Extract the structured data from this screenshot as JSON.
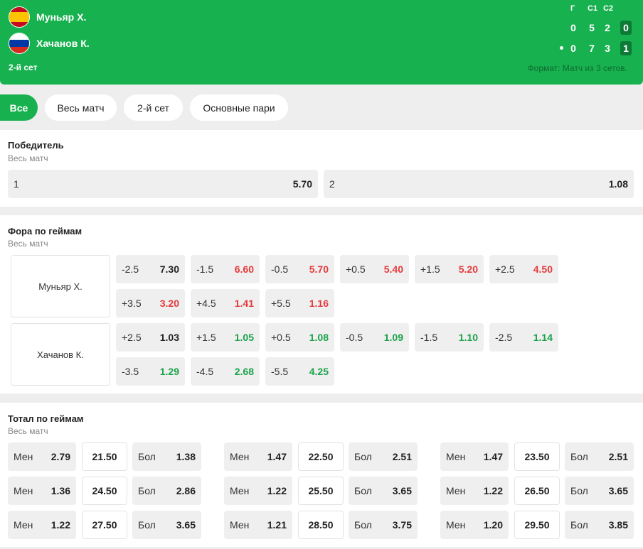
{
  "match": {
    "team1": {
      "name": "Муньяр Х.",
      "flag": "spain-flag-icon",
      "colors": [
        "#c60b1e",
        "#ffc400",
        "#c60b1e"
      ]
    },
    "team2": {
      "name": "Хачанов К.",
      "flag": "russia-flag-icon",
      "colors": [
        "#ffffff",
        "#0039a6",
        "#d52b1e"
      ]
    },
    "set_label": "2-й сет",
    "format": "Формат: Матч из 3 сетов.",
    "score_headers": [
      "Г",
      "С1",
      "С2"
    ],
    "team1_scores": [
      "0",
      "5",
      "2",
      "0"
    ],
    "team2_scores": [
      "0",
      "7",
      "3",
      "1"
    ],
    "serving": "team2"
  },
  "tabs": [
    "Все",
    "Весь матч",
    "2-й сет",
    "Основные пари"
  ],
  "active_tab": "Все",
  "winner": {
    "title": "Победитель",
    "subtitle": "Весь матч",
    "options": [
      {
        "label": "1",
        "odds": "5.70"
      },
      {
        "label": "2",
        "odds": "1.08"
      }
    ]
  },
  "handicap": {
    "title": "Фора по геймам",
    "subtitle": "Весь матч",
    "players": [
      {
        "name": "Муньяр Х.",
        "rows": [
          [
            {
              "line": "-2.5",
              "odds": "7.30",
              "trend": "none"
            },
            {
              "line": "-1.5",
              "odds": "6.60",
              "trend": "down"
            },
            {
              "line": "-0.5",
              "odds": "5.70",
              "trend": "down"
            },
            {
              "line": "+0.5",
              "odds": "5.40",
              "trend": "down"
            },
            {
              "line": "+1.5",
              "odds": "5.20",
              "trend": "down"
            },
            {
              "line": "+2.5",
              "odds": "4.50",
              "trend": "down"
            }
          ],
          [
            {
              "line": "+3.5",
              "odds": "3.20",
              "trend": "down"
            },
            {
              "line": "+4.5",
              "odds": "1.41",
              "trend": "down"
            },
            {
              "line": "+5.5",
              "odds": "1.16",
              "trend": "down"
            }
          ]
        ]
      },
      {
        "name": "Хачанов К.",
        "rows": [
          [
            {
              "line": "+2.5",
              "odds": "1.03",
              "trend": "none"
            },
            {
              "line": "+1.5",
              "odds": "1.05",
              "trend": "up"
            },
            {
              "line": "+0.5",
              "odds": "1.08",
              "trend": "up"
            },
            {
              "line": "-0.5",
              "odds": "1.09",
              "trend": "up"
            },
            {
              "line": "-1.5",
              "odds": "1.10",
              "trend": "up"
            },
            {
              "line": "-2.5",
              "odds": "1.14",
              "trend": "up"
            }
          ],
          [
            {
              "line": "-3.5",
              "odds": "1.29",
              "trend": "up"
            },
            {
              "line": "-4.5",
              "odds": "2.68",
              "trend": "up"
            },
            {
              "line": "-5.5",
              "odds": "4.25",
              "trend": "up"
            }
          ]
        ]
      }
    ]
  },
  "totals": {
    "title": "Тотал по геймам",
    "subtitle": "Весь матч",
    "under_label": "Мен",
    "over_label": "Бол",
    "lines": [
      {
        "under": "2.79",
        "line": "21.50",
        "over": "1.38"
      },
      {
        "under": "1.47",
        "line": "22.50",
        "over": "2.51"
      },
      {
        "under": "1.47",
        "line": "23.50",
        "over": "2.51"
      },
      {
        "under": "1.36",
        "line": "24.50",
        "over": "2.86"
      },
      {
        "under": "1.22",
        "line": "25.50",
        "over": "3.65"
      },
      {
        "under": "1.22",
        "line": "26.50",
        "over": "3.65"
      },
      {
        "under": "1.22",
        "line": "27.50",
        "over": "3.65"
      },
      {
        "under": "1.21",
        "line": "28.50",
        "over": "3.75"
      },
      {
        "under": "1.20",
        "line": "29.50",
        "over": "3.85"
      }
    ]
  },
  "colors": {
    "brand": "#18b14f",
    "odds_down": "#e5393b",
    "odds_up": "#1ba24a"
  }
}
